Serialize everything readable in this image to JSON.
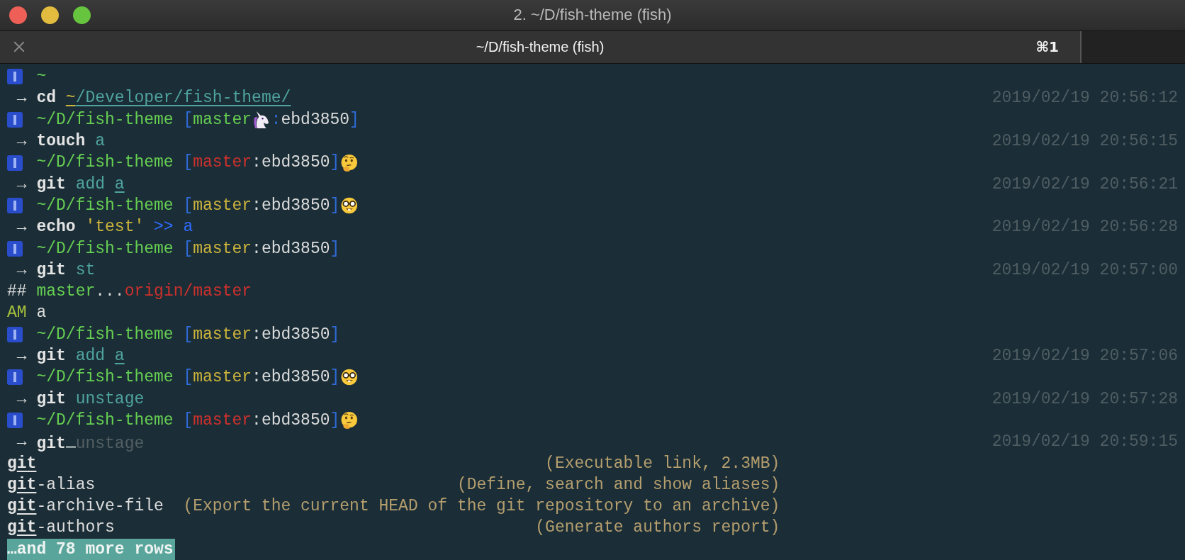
{
  "window": {
    "title": "2. ~/D/fish-theme (fish)"
  },
  "tab": {
    "title": "~/D/fish-theme (fish)",
    "shortcut": "⌘1"
  },
  "lines": [
    {
      "kind": "prompt",
      "segments": [
        {
          "text": "~",
          "kind": "path"
        }
      ]
    },
    {
      "kind": "command",
      "arrow": "→",
      "segments": [
        {
          "text": "cd ",
          "kind": "command"
        },
        {
          "text": "~",
          "kind": "home-underline"
        },
        {
          "text": "/Developer/fish-theme/",
          "kind": "arg-underline"
        }
      ],
      "time": "2019/02/19 20:56:12"
    },
    {
      "kind": "prompt",
      "segments": [
        {
          "text": "~/D/fish-theme",
          "kind": "path"
        },
        {
          "text": " [",
          "kind": "bracket"
        },
        {
          "text": "master",
          "kind": "clean"
        },
        {
          "kind": "unicorn"
        },
        {
          "text": ":",
          "kind": "bracket"
        },
        {
          "text": "ebd3850",
          "kind": "plain"
        },
        {
          "text": "]",
          "kind": "bracket"
        }
      ]
    },
    {
      "kind": "command",
      "arrow": "→",
      "segments": [
        {
          "text": "touch",
          "kind": "command"
        },
        {
          "text": " a",
          "kind": "arg"
        }
      ],
      "time": "2019/02/19 20:56:15"
    },
    {
      "kind": "prompt",
      "segments": [
        {
          "text": "~/D/fish-theme",
          "kind": "path"
        },
        {
          "text": " [",
          "kind": "bracket"
        },
        {
          "text": "master",
          "kind": "modified"
        },
        {
          "text": ":ebd3850",
          "kind": "plain"
        },
        {
          "text": "]",
          "kind": "bracket"
        },
        {
          "kind": "thinking"
        }
      ]
    },
    {
      "kind": "command",
      "arrow": "→",
      "segments": [
        {
          "text": "git",
          "kind": "command"
        },
        {
          "text": " add ",
          "kind": "arg"
        },
        {
          "text": "a",
          "kind": "arg-underline"
        }
      ],
      "time": "2019/02/19 20:56:21"
    },
    {
      "kind": "prompt",
      "segments": [
        {
          "text": "~/D/fish-theme",
          "kind": "path"
        },
        {
          "text": " [",
          "kind": "bracket"
        },
        {
          "text": "master",
          "kind": "staged"
        },
        {
          "text": ":ebd3850",
          "kind": "plain"
        },
        {
          "text": "]",
          "kind": "bracket"
        },
        {
          "kind": "nerd"
        }
      ]
    },
    {
      "kind": "command",
      "arrow": "→",
      "segments": [
        {
          "text": "echo",
          "kind": "command"
        },
        {
          "text": " 'test'",
          "kind": "quote"
        },
        {
          "text": " >> a",
          "kind": "redirect"
        }
      ],
      "time": "2019/02/19 20:56:28"
    },
    {
      "kind": "prompt",
      "segments": [
        {
          "text": "~/D/fish-theme",
          "kind": "path"
        },
        {
          "text": " [",
          "kind": "bracket"
        },
        {
          "text": "master",
          "kind": "staged"
        },
        {
          "text": ":ebd3850",
          "kind": "plain"
        },
        {
          "text": "]",
          "kind": "bracket"
        }
      ]
    },
    {
      "kind": "command",
      "arrow": "→",
      "segments": [
        {
          "text": "git",
          "kind": "command"
        },
        {
          "text": " st",
          "kind": "arg"
        }
      ],
      "time": "2019/02/19 20:57:00"
    },
    {
      "kind": "output",
      "segments": [
        {
          "text": "## ",
          "kind": "plain"
        },
        {
          "text": "master",
          "kind": "clean"
        },
        {
          "text": "...",
          "kind": "plain"
        },
        {
          "text": "origin/master",
          "kind": "modified"
        }
      ]
    },
    {
      "kind": "output",
      "segments": [
        {
          "text": "AM",
          "kind": "added"
        },
        {
          "text": " a",
          "kind": "plain"
        }
      ]
    },
    {
      "kind": "prompt",
      "segments": [
        {
          "text": "~/D/fish-theme",
          "kind": "path"
        },
        {
          "text": " [",
          "kind": "bracket"
        },
        {
          "text": "master",
          "kind": "staged"
        },
        {
          "text": ":ebd3850",
          "kind": "plain"
        },
        {
          "text": "]",
          "kind": "bracket"
        }
      ]
    },
    {
      "kind": "command",
      "arrow": "→",
      "segments": [
        {
          "text": "git",
          "kind": "command"
        },
        {
          "text": " add ",
          "kind": "arg"
        },
        {
          "text": "a",
          "kind": "arg-underline"
        }
      ],
      "time": "2019/02/19 20:57:06"
    },
    {
      "kind": "prompt",
      "segments": [
        {
          "text": "~/D/fish-theme",
          "kind": "path"
        },
        {
          "text": " [",
          "kind": "bracket"
        },
        {
          "text": "master",
          "kind": "staged"
        },
        {
          "text": ":ebd3850",
          "kind": "plain"
        },
        {
          "text": "]",
          "kind": "bracket"
        },
        {
          "kind": "nerd"
        }
      ]
    },
    {
      "kind": "command",
      "arrow": "→",
      "segments": [
        {
          "text": "git",
          "kind": "command"
        },
        {
          "text": " unstage",
          "kind": "arg"
        }
      ],
      "time": "2019/02/19 20:57:28"
    },
    {
      "kind": "prompt",
      "segments": [
        {
          "text": "~/D/fish-theme",
          "kind": "path"
        },
        {
          "text": " [",
          "kind": "bracket"
        },
        {
          "text": "master",
          "kind": "modified"
        },
        {
          "text": ":ebd3850",
          "kind": "plain"
        },
        {
          "text": "]",
          "kind": "bracket"
        },
        {
          "kind": "thinking"
        }
      ]
    },
    {
      "kind": "command",
      "arrow": "→",
      "segments": [
        {
          "text": "git",
          "kind": "command"
        },
        {
          "kind": "cursor"
        },
        {
          "text": "unstage",
          "kind": "suggestion"
        }
      ],
      "time": "2019/02/19 20:59:15"
    },
    {
      "kind": "completion",
      "segments": [
        {
          "text": "g",
          "kind": "match"
        },
        {
          "text": "it",
          "kind": "match-underline"
        }
      ],
      "description": "(Executable link, 2.3MB)"
    },
    {
      "kind": "completion",
      "segments": [
        {
          "text": "g",
          "kind": "match"
        },
        {
          "text": "it",
          "kind": "match-underline"
        },
        {
          "text": "-alias",
          "kind": "plain"
        }
      ],
      "description": "(Define, search and show aliases)"
    },
    {
      "kind": "completion",
      "segments": [
        {
          "text": "g",
          "kind": "match"
        },
        {
          "text": "it",
          "kind": "match-underline"
        },
        {
          "text": "-archive-file",
          "kind": "plain"
        }
      ],
      "description": "(Export the current HEAD of the git repository to an archive)"
    },
    {
      "kind": "completion",
      "segments": [
        {
          "text": "g",
          "kind": "match"
        },
        {
          "text": "it",
          "kind": "match-underline"
        },
        {
          "text": "-authors",
          "kind": "plain"
        }
      ],
      "description": "(Generate authors report)"
    },
    {
      "kind": "pager",
      "text": "…and 78 more rows"
    }
  ]
}
